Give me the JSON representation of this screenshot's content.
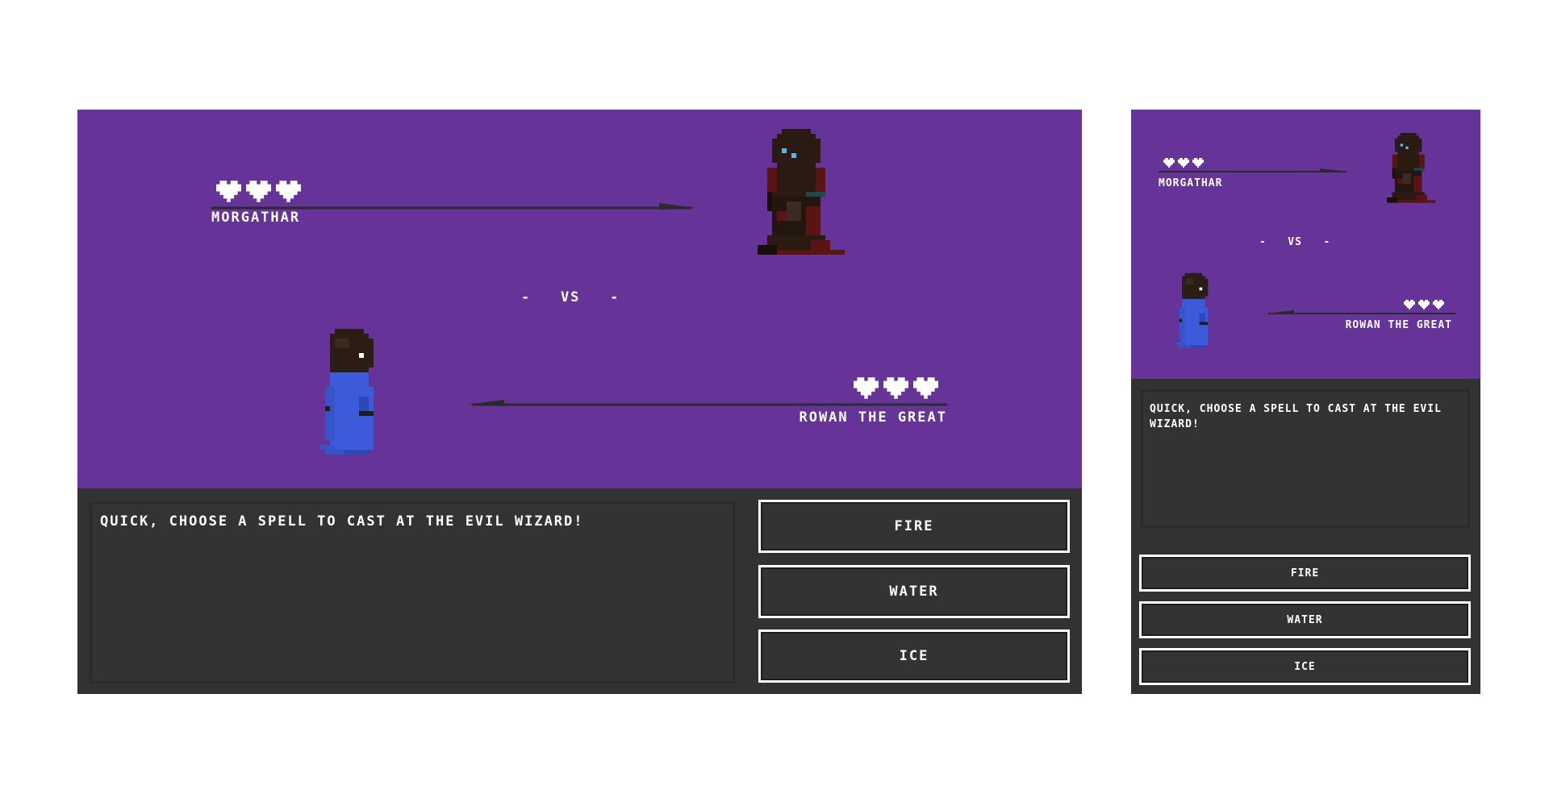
{
  "enemy": {
    "name": "MORGATHAR",
    "hearts": 3
  },
  "player": {
    "name": "ROWAN THE GREAT",
    "hearts": 3
  },
  "versus_text": "-   VS   -",
  "message": "QUICK, CHOOSE A SPELL TO CAST AT THE EVIL WIZARD!",
  "spells": [
    {
      "label": "FIRE"
    },
    {
      "label": "WATER"
    },
    {
      "label": "ICE"
    }
  ],
  "colors": {
    "stage_bg": "#663399",
    "panel_bg": "#333333",
    "heart": "#ffffff",
    "player_robe": "#3b5bdb",
    "enemy_robe": "#5a1414"
  }
}
